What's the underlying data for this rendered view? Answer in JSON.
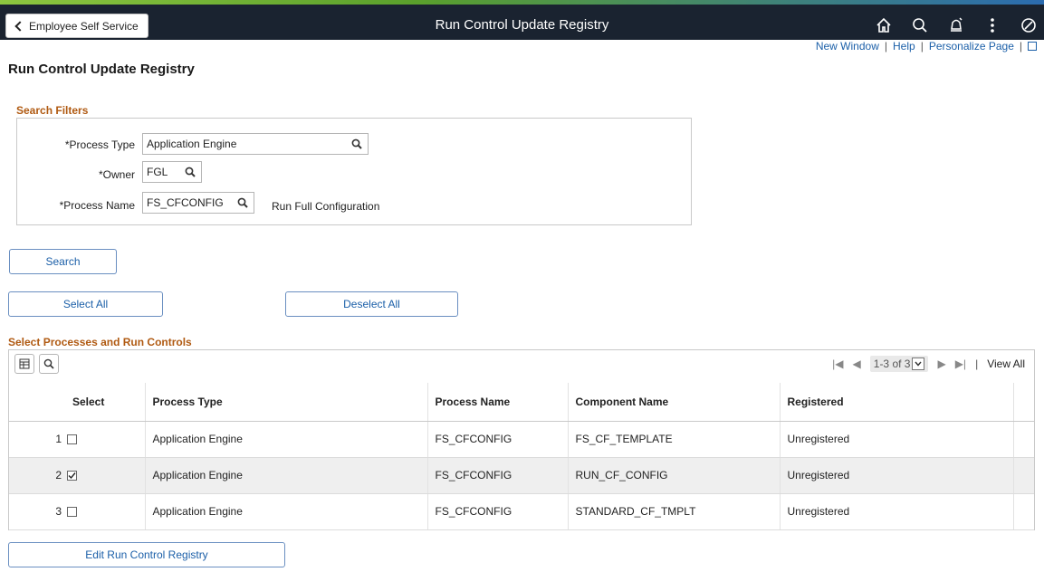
{
  "header": {
    "back_label": "Employee Self Service",
    "title": "Run Control Update Registry",
    "icons": [
      "home-icon",
      "search-icon",
      "notification-icon",
      "actions-menu-icon",
      "navbar-icon"
    ]
  },
  "links": {
    "new_window": "New Window",
    "help": "Help",
    "personalize": "Personalize Page",
    "separator": "|"
  },
  "page_title": "Run Control Update Registry",
  "search_filters": {
    "title": "Search Filters",
    "process_type_label": "*Process Type",
    "process_type_value": "Application Engine",
    "owner_label": "*Owner",
    "owner_value": "FGL",
    "process_name_label": "*Process Name",
    "process_name_value": "FS_CFCONFIG",
    "process_name_desc": "Run Full Configuration"
  },
  "buttons": {
    "search": "Search",
    "select_all": "Select All",
    "deselect_all": "Deselect All",
    "edit_registry": "Edit Run Control Registry"
  },
  "grid": {
    "title": "Select Processes and Run Controls",
    "pager": {
      "range": "1-3 of 3",
      "view_all": "View All",
      "separator": "|"
    },
    "columns": [
      "",
      "Select",
      "Process Type",
      "Process Name",
      "Component Name",
      "Registered"
    ],
    "rows": [
      {
        "num": "1",
        "checked": false,
        "process_type": "Application Engine",
        "process_name": "FS_CFCONFIG",
        "component": "FS_CF_TEMPLATE",
        "registered": "Unregistered"
      },
      {
        "num": "2",
        "checked": true,
        "process_type": "Application Engine",
        "process_name": "FS_CFCONFIG",
        "component": "RUN_CF_CONFIG",
        "registered": "Unregistered"
      },
      {
        "num": "3",
        "checked": false,
        "process_type": "Application Engine",
        "process_name": "FS_CFCONFIG",
        "component": "STANDARD_CF_TMPLT",
        "registered": "Unregistered"
      }
    ]
  },
  "colors": {
    "banner": "#1a2330",
    "link": "#1b5fa8",
    "section_title": "#b05a12",
    "row_shade": "#efefef"
  }
}
